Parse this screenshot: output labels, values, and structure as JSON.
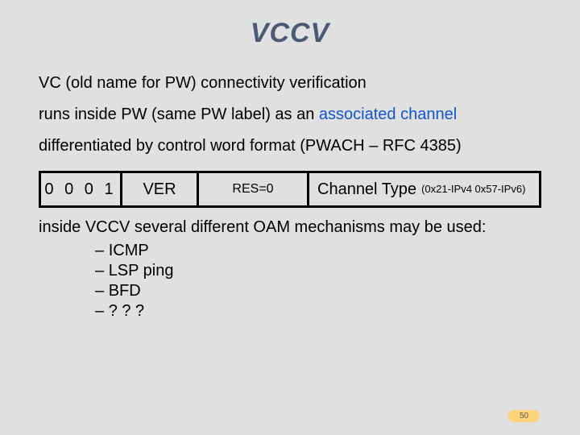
{
  "title": "VCCV",
  "para1": "VC (old name for PW) connectivity verification",
  "para2_pre": "runs inside PW (same PW label) as an ",
  "para2_assoc": "associated channel",
  "para3": "differentiated by control word format (PWACH – RFC 4385)",
  "diagram": {
    "bits": "0 0 0 1",
    "ver": "VER",
    "res": "RES=0",
    "chtype": "Channel Type",
    "chtype_small": "(0x21-IPv4 0x57-IPv6)"
  },
  "para4": "inside VCCV several different OAM mechanisms may be used:",
  "mechanisms": [
    "ICMP",
    "LSP ping",
    "BFD",
    "? ? ?"
  ],
  "page": "50"
}
